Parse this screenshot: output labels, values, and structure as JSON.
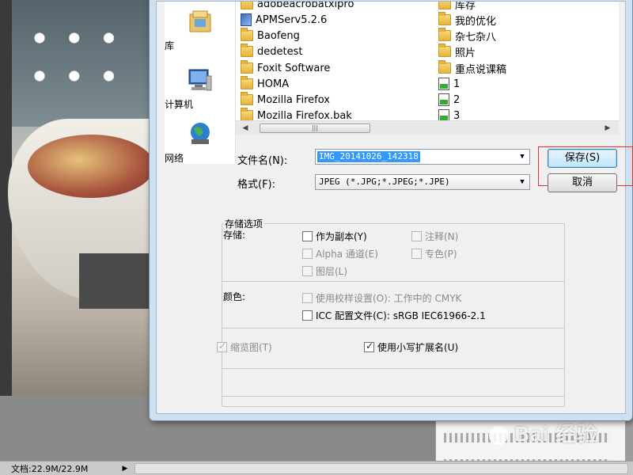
{
  "status": {
    "doc_label": "文档:22.9M/22.9M",
    "arrow": "▶"
  },
  "watermark": {
    "text": "Bai  经验"
  },
  "nav": [
    {
      "label": "库",
      "icon": "library-icon"
    },
    {
      "label": "计算机",
      "icon": "computer-icon"
    },
    {
      "label": "网络",
      "icon": "network-icon"
    }
  ],
  "files": {
    "col1": [
      {
        "name": "adobeacrobatxipro",
        "type": "folder"
      },
      {
        "name": "APMServ5.2.6",
        "type": "exe"
      },
      {
        "name": "Baofeng",
        "type": "folder"
      },
      {
        "name": "dedetest",
        "type": "folder"
      },
      {
        "name": "Foxit Software",
        "type": "folder"
      },
      {
        "name": "HOMA",
        "type": "folder"
      },
      {
        "name": "Mozilla Firefox",
        "type": "folder"
      },
      {
        "name": "Mozilla Firefox.bak",
        "type": "folder"
      }
    ],
    "col2": [
      {
        "name": "库存",
        "type": "folder"
      },
      {
        "name": "我的优化",
        "type": "folder"
      },
      {
        "name": "杂七杂八",
        "type": "folder"
      },
      {
        "name": "照片",
        "type": "folder"
      },
      {
        "name": "重点说课稿",
        "type": "folder"
      },
      {
        "name": "1",
        "type": "jpg"
      },
      {
        "name": "2",
        "type": "jpg"
      },
      {
        "name": "3",
        "type": "jpg"
      }
    ]
  },
  "scroll": {
    "left": "◀",
    "right": "▶",
    "grip": "|||"
  },
  "form": {
    "filename_label": "文件名(N):",
    "filename_value": "IMG_20141026_142318",
    "format_label": "格式(F):",
    "format_value": "JPEG (*.JPG;*.JPEG;*.JPE)",
    "dropdown_glyph": "▼",
    "save_label": "保存(S)",
    "cancel_label": "取消"
  },
  "options": {
    "title": "存储选项",
    "storage_label": "存储:",
    "as_copy": "作为副本(Y)",
    "notes": "注释(N)",
    "alpha": "Alpha 通道(E)",
    "spot": "专色(P)",
    "layers": "图层(L)",
    "color_label": "颜色:",
    "proof": "使用校样设置(O): 工作中的 CMYK",
    "icc": "ICC 配置文件(C): sRGB IEC61966-2.1",
    "thumbnail": "缩览图(T)",
    "lowercase_ext": "使用小写扩展名(U)"
  }
}
